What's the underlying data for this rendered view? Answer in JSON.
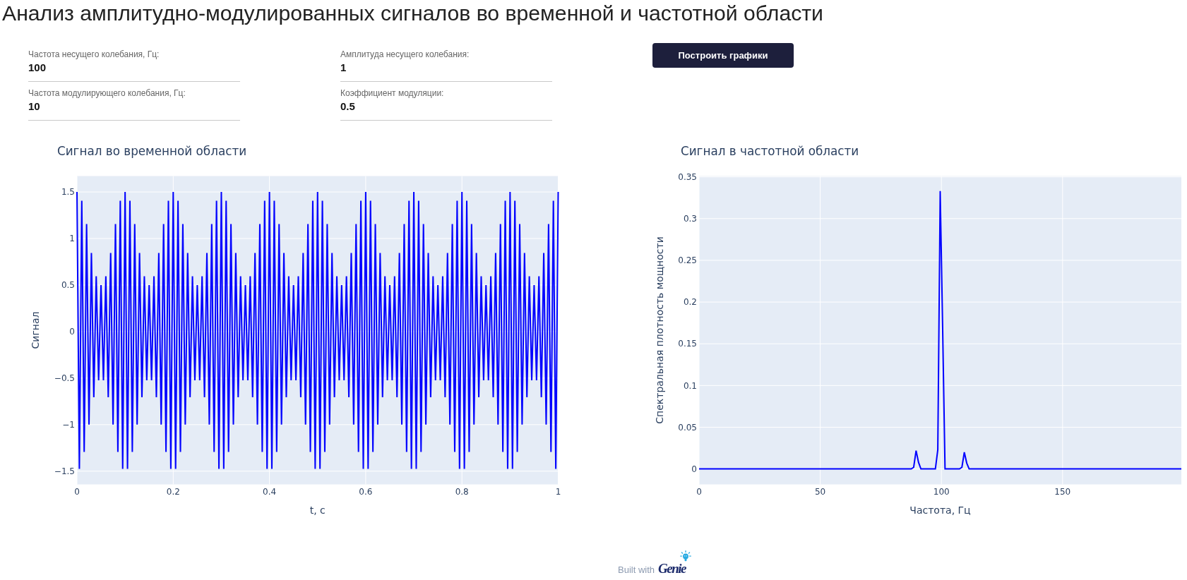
{
  "page": {
    "title": "Анализ амплитудно-модулированных сигналов во временной и частотной области"
  },
  "form": {
    "fields": [
      {
        "label": "Частота несущего колебания, Гц:",
        "value": "100"
      },
      {
        "label": "Амплитуда несущего колебания:",
        "value": "1"
      },
      {
        "label": "Частота модулирующего колебания, Гц:",
        "value": "10"
      },
      {
        "label": "Коэффициент модуляции:",
        "value": "0.5"
      }
    ],
    "button": {
      "label": "Построить графики"
    }
  },
  "charts": [
    {
      "chart_data": {
        "type": "line",
        "title": "Сигнал во временной области",
        "xlabel": "t, с",
        "ylabel": "Сигнал",
        "grid": true,
        "x": [
          0,
          0.005,
          0.01,
          0.015,
          0.02,
          0.025,
          0.03,
          0.035,
          0.04,
          0.045,
          0.05,
          0.055,
          0.06,
          0.065,
          0.07,
          0.075,
          0.08,
          0.085,
          0.09,
          0.095,
          0.1,
          0.105,
          0.11,
          0.115,
          0.12,
          0.125,
          0.13,
          0.135,
          0.14,
          0.145,
          0.15,
          0.155,
          0.16,
          0.165,
          0.17,
          0.175,
          0.18,
          0.185,
          0.19,
          0.195,
          0.2,
          0.205,
          0.21,
          0.215,
          0.22,
          0.225,
          0.23,
          0.235,
          0.24,
          0.245,
          0.25,
          0.255,
          0.26,
          0.265,
          0.27,
          0.275,
          0.28,
          0.285,
          0.29,
          0.295,
          0.3,
          0.305,
          0.31,
          0.315,
          0.32,
          0.325,
          0.33,
          0.335,
          0.34,
          0.345,
          0.35,
          0.355,
          0.36,
          0.365,
          0.37,
          0.375,
          0.38,
          0.385,
          0.39,
          0.395,
          0.4,
          0.405,
          0.41,
          0.415,
          0.42,
          0.425,
          0.43,
          0.435,
          0.44,
          0.445,
          0.45,
          0.455,
          0.46,
          0.465,
          0.47,
          0.475,
          0.48,
          0.485,
          0.49,
          0.495,
          0.5,
          0.505,
          0.51,
          0.515,
          0.52,
          0.525,
          0.53,
          0.535,
          0.54,
          0.545,
          0.55,
          0.555,
          0.56,
          0.565,
          0.57,
          0.575,
          0.58,
          0.585,
          0.59,
          0.595,
          0.6,
          0.605,
          0.61,
          0.615,
          0.62,
          0.625,
          0.63,
          0.635,
          0.64,
          0.645,
          0.65,
          0.655,
          0.66,
          0.665,
          0.67,
          0.675,
          0.68,
          0.685,
          0.69,
          0.695,
          0.7,
          0.705,
          0.71,
          0.715,
          0.72,
          0.725,
          0.73,
          0.735,
          0.74,
          0.745,
          0.75,
          0.755,
          0.76,
          0.765,
          0.77,
          0.775,
          0.78,
          0.785,
          0.79,
          0.795,
          0.8,
          0.805,
          0.81,
          0.815,
          0.82,
          0.825,
          0.83,
          0.835,
          0.84,
          0.845,
          0.85,
          0.855,
          0.86,
          0.865,
          0.87,
          0.875,
          0.88,
          0.885,
          0.89,
          0.895,
          0.9,
          0.905,
          0.91,
          0.915,
          0.92,
          0.925,
          0.93,
          0.935,
          0.94,
          0.945,
          0.95,
          0.955,
          0.96,
          0.965,
          0.97,
          0.975,
          0.98,
          0.985,
          0.99,
          0.995,
          1
        ],
        "values": [
          1.5,
          -1.476,
          1.405,
          -1.294,
          1.155,
          -1,
          0.845,
          -0.706,
          0.595,
          -0.524,
          0.5,
          -0.524,
          0.595,
          -0.706,
          0.845,
          -1,
          1.155,
          -1.294,
          1.405,
          -1.476,
          1.5,
          -1.476,
          1.405,
          -1.294,
          1.155,
          -1,
          0.845,
          -0.706,
          0.595,
          -0.524,
          0.5,
          -0.524,
          0.595,
          -0.706,
          0.845,
          -1,
          1.155,
          -1.294,
          1.405,
          -1.476,
          1.5,
          -1.476,
          1.405,
          -1.294,
          1.155,
          -1,
          0.845,
          -0.706,
          0.595,
          -0.524,
          0.5,
          -0.524,
          0.595,
          -0.706,
          0.845,
          -1,
          1.155,
          -1.294,
          1.405,
          -1.476,
          1.5,
          -1.476,
          1.405,
          -1.294,
          1.155,
          -1,
          0.845,
          -0.706,
          0.595,
          -0.524,
          0.5,
          -0.524,
          0.595,
          -0.706,
          0.845,
          -1,
          1.155,
          -1.294,
          1.405,
          -1.476,
          1.5,
          -1.476,
          1.405,
          -1.294,
          1.155,
          -1,
          0.845,
          -0.706,
          0.595,
          -0.524,
          0.5,
          -0.524,
          0.595,
          -0.706,
          0.845,
          -1,
          1.155,
          -1.294,
          1.405,
          -1.476,
          1.5,
          -1.476,
          1.405,
          -1.294,
          1.155,
          -1,
          0.845,
          -0.706,
          0.595,
          -0.524,
          0.5,
          -0.524,
          0.595,
          -0.706,
          0.845,
          -1,
          1.155,
          -1.294,
          1.405,
          -1.476,
          1.5,
          -1.476,
          1.405,
          -1.294,
          1.155,
          -1,
          0.845,
          -0.706,
          0.595,
          -0.524,
          0.5,
          -0.524,
          0.595,
          -0.706,
          0.845,
          -1,
          1.155,
          -1.294,
          1.405,
          -1.476,
          1.5,
          -1.476,
          1.405,
          -1.294,
          1.155,
          -1,
          0.845,
          -0.706,
          0.595,
          -0.524,
          0.5,
          -0.524,
          0.595,
          -0.706,
          0.845,
          -1,
          1.155,
          -1.294,
          1.405,
          -1.476,
          1.5,
          -1.476,
          1.405,
          -1.294,
          1.155,
          -1,
          0.845,
          -0.706,
          0.595,
          -0.524,
          0.5,
          -0.524,
          0.595,
          -0.706,
          0.845,
          -1,
          1.155,
          -1.294,
          1.405,
          -1.476,
          1.5,
          -1.476,
          1.405,
          -1.294,
          1.155,
          -1,
          0.845,
          -0.706,
          0.595,
          -0.524,
          0.5,
          -0.524,
          0.595,
          -0.706,
          0.845,
          -1,
          1.155,
          -1.294,
          1.405,
          -1.476,
          1.5
        ],
        "xlim": [
          0,
          1
        ],
        "ylim": [
          -1.642,
          1.671
        ],
        "xticks": [
          0,
          0.2,
          0.4,
          0.6,
          0.8,
          1
        ],
        "yticks": [
          {
            "value": -1.5,
            "label": "−1.5"
          },
          {
            "value": -1,
            "label": "−1"
          },
          {
            "value": -0.5,
            "label": "−0.5"
          },
          0,
          0.5,
          1,
          1.5
        ]
      }
    },
    {
      "chart_data": {
        "type": "line",
        "title": "Сигнал в частотной области",
        "xlabel": "Частота, Гц",
        "ylabel": "Спектральная плотность мощности",
        "grid": true,
        "x": [
          0,
          87.562,
          88.557,
          89.552,
          90.547,
          91.542,
          97.512,
          98.507,
          99.502,
          100.498,
          101.493,
          107.463,
          108.458,
          109.453,
          110.448,
          111.443,
          199.005
        ],
        "values": [
          0,
          0,
          0.002,
          0.022,
          0.008,
          0,
          0,
          0.023,
          0.333,
          0.17,
          0,
          0,
          0.002,
          0.02,
          0.007,
          0,
          0
        ],
        "xlim": [
          0,
          199.005
        ],
        "ylim": [
          -0.0185,
          0.351
        ],
        "xticks": [
          0,
          50,
          100,
          150
        ],
        "yticks": [
          0,
          0.05,
          0.1,
          0.15,
          0.2,
          0.25,
          0.3,
          0.35
        ]
      }
    }
  ],
  "footer": {
    "text": "Built with",
    "logo": "Genie"
  }
}
